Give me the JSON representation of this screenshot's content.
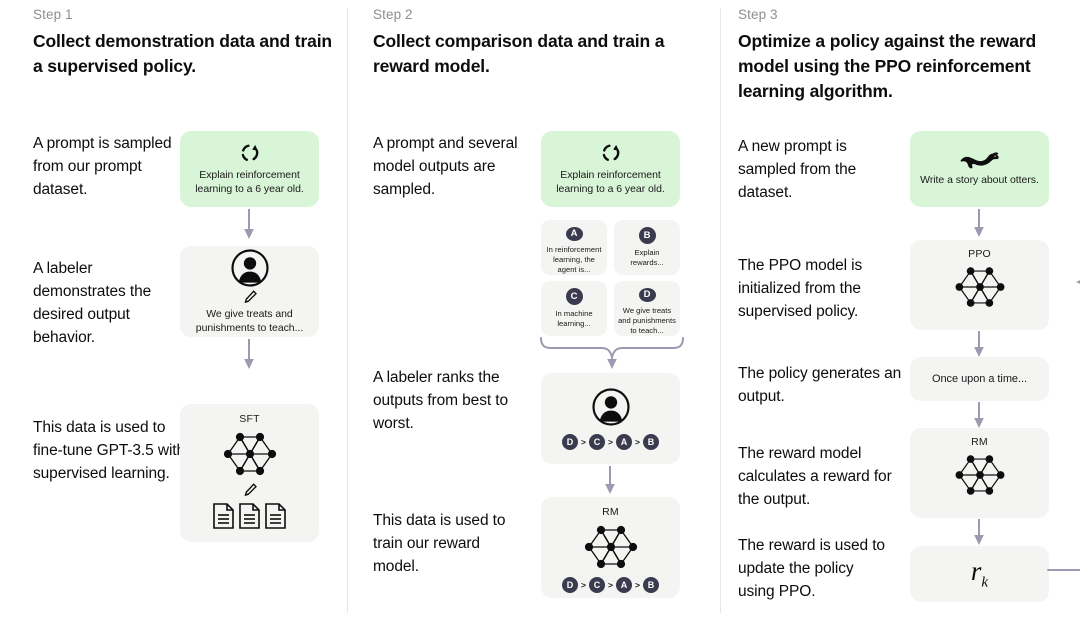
{
  "theme": {
    "background": "#ffffff",
    "prompt_card_bg": "#d9f5d8",
    "model_card_bg": "#f4f4f2",
    "badge_bg": "#3b3b4f",
    "arrow_color": "#9a9ab0",
    "divider_color": "#e6e6e6",
    "text_color": "#0d0d0d",
    "muted_text_color": "#8e8e8e"
  },
  "columns": [
    {
      "step_label": "Step 1",
      "title": "Collect demonstration data and train a supervised policy.",
      "paragraphs": [
        "A prompt is sampled from our prompt dataset.",
        "A labeler demonstrates the desired output behavior.",
        "This data is used to fine-tune GPT-3.5 with supervised learning."
      ],
      "cards": [
        {
          "kind": "prompt",
          "icon": "refresh-cycle-icon",
          "text": "Explain reinforcement learning to a 6 year old."
        },
        {
          "kind": "labeler",
          "icon": "person-circle-icon",
          "sub_icon": "pencil-icon",
          "text": "We give treats and punishments to teach..."
        },
        {
          "kind": "model",
          "caption": "SFT",
          "icon": "neural-network-icon",
          "sub_icon": "pencil-icon",
          "extra_icon": "documents-icon"
        }
      ]
    },
    {
      "step_label": "Step 2",
      "title": "Collect comparison data and train a reward model.",
      "paragraphs": [
        "A prompt and several model outputs are sampled.",
        "A labeler ranks the outputs from best to worst.",
        "This data is used to train our reward model."
      ],
      "cards": [
        {
          "kind": "prompt",
          "icon": "refresh-cycle-icon",
          "text": "Explain reinforcement learning to a 6 year old."
        },
        {
          "kind": "outputs",
          "options": [
            {
              "letter": "A",
              "text": "In reinforcement learning, the agent is..."
            },
            {
              "letter": "B",
              "text": "Explain rewards..."
            },
            {
              "letter": "C",
              "text": "In machine learning..."
            },
            {
              "letter": "D",
              "text": "We give treats and punishments to teach..."
            }
          ]
        },
        {
          "kind": "ranking",
          "icon": "person-circle-icon",
          "ranking": [
            "D",
            "C",
            "A",
            "B"
          ],
          "separator": ">"
        },
        {
          "kind": "model",
          "caption": "RM",
          "icon": "neural-network-icon",
          "ranking": [
            "D",
            "C",
            "A",
            "B"
          ],
          "separator": ">"
        }
      ]
    },
    {
      "step_label": "Step 3",
      "title": "Optimize a policy against the reward model using the PPO reinforcement learning algorithm.",
      "paragraphs": [
        "A new prompt is sampled from the dataset.",
        "The PPO model is initialized from the supervised policy.",
        "The policy generates an output.",
        "The reward model calculates a reward for the output.",
        "The reward is used to update the policy using PPO."
      ],
      "cards": [
        {
          "kind": "prompt",
          "icon": "otter-icon",
          "text": "Write a story about otters."
        },
        {
          "kind": "model",
          "caption": "PPO",
          "icon": "neural-network-icon"
        },
        {
          "kind": "output",
          "text": "Once upon a time..."
        },
        {
          "kind": "model",
          "caption": "RM",
          "icon": "neural-network-icon"
        },
        {
          "kind": "reward",
          "symbol": "r",
          "subscript": "k"
        }
      ]
    }
  ]
}
